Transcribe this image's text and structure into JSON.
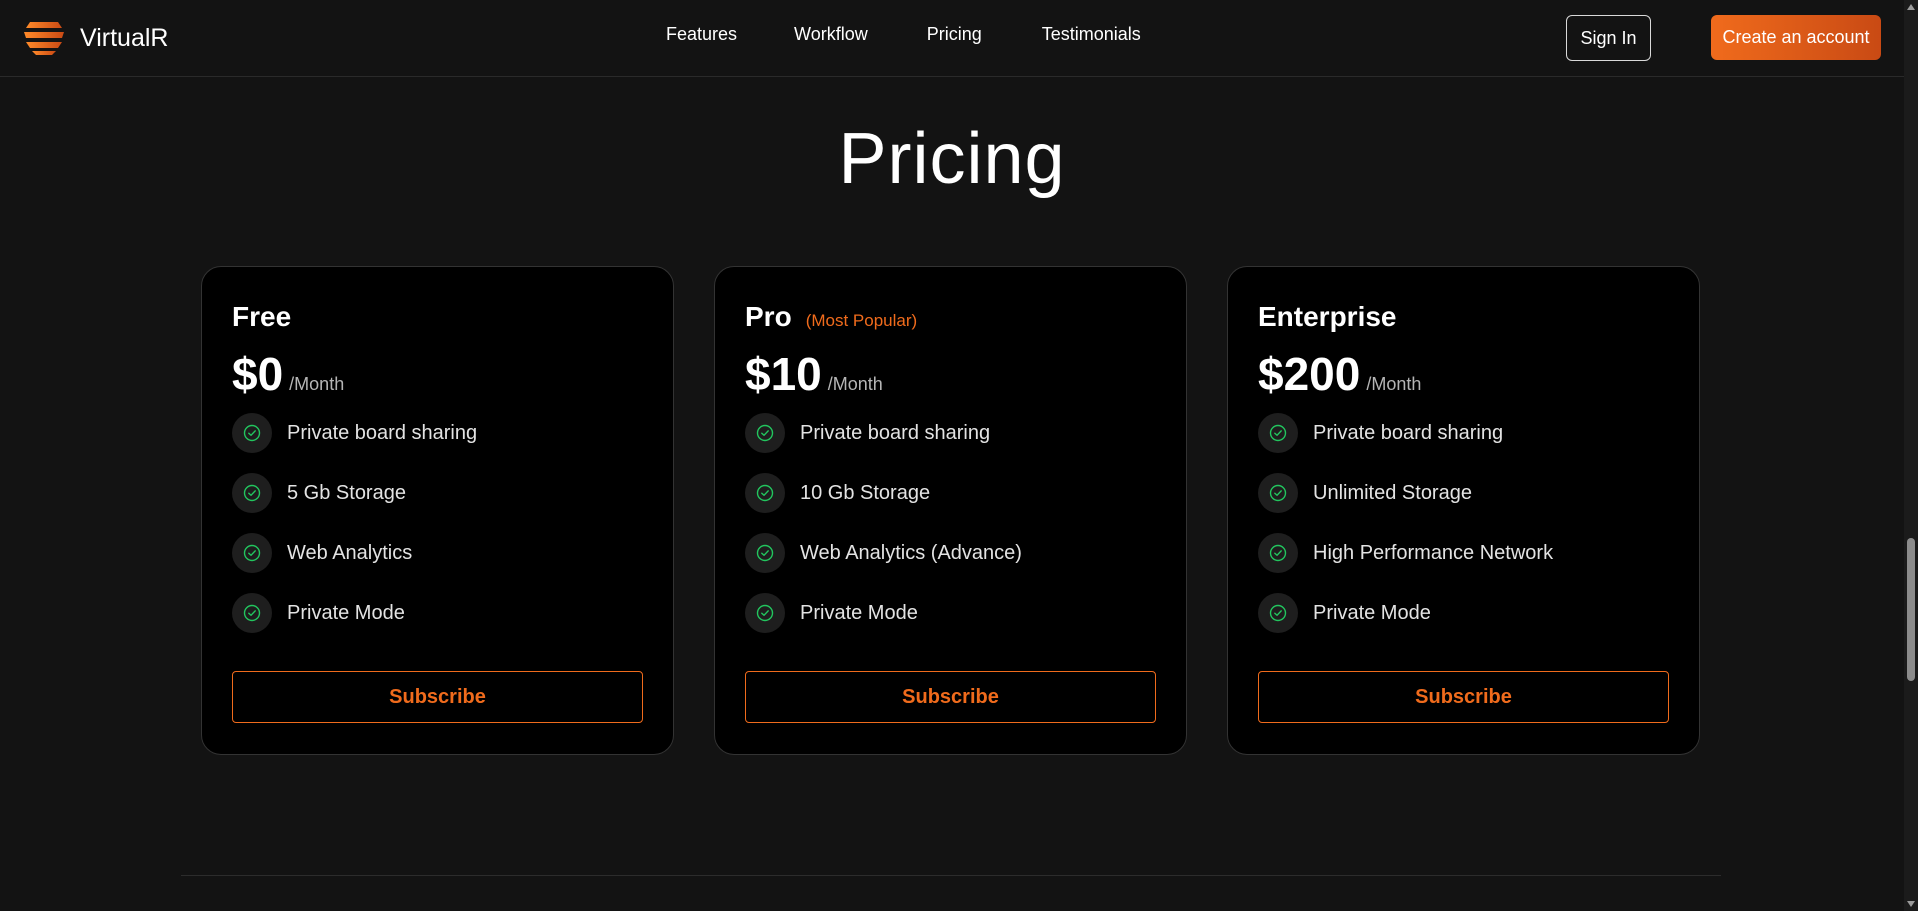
{
  "header": {
    "brand": "VirtualR",
    "nav": [
      "Features",
      "Workflow",
      "Pricing",
      "Testimonials"
    ],
    "sign_in": "Sign In",
    "create_account": "Create an account"
  },
  "pricing": {
    "title": "Pricing",
    "plans": [
      {
        "name": "Free",
        "badge": "",
        "price": "$0",
        "period": "/Month",
        "features": [
          "Private board sharing",
          "5 Gb Storage",
          "Web Analytics",
          "Private Mode"
        ],
        "cta": "Subscribe"
      },
      {
        "name": "Pro",
        "badge": "(Most Popular)",
        "price": "$10",
        "period": "/Month",
        "features": [
          "Private board sharing",
          "10 Gb Storage",
          "Web Analytics (Advance)",
          "Private Mode"
        ],
        "cta": "Subscribe"
      },
      {
        "name": "Enterprise",
        "badge": "",
        "price": "$200",
        "period": "/Month",
        "features": [
          "Private board sharing",
          "Unlimited Storage",
          "High Performance Network",
          "Private Mode"
        ],
        "cta": "Subscribe"
      }
    ]
  },
  "icons": {
    "logo": "layered-disc-logo-icon",
    "feature_check": "check-circle-icon"
  },
  "colors": {
    "background": "#131313",
    "card": "#000000",
    "accent": "#f06b1c",
    "check": "#22c55e"
  }
}
